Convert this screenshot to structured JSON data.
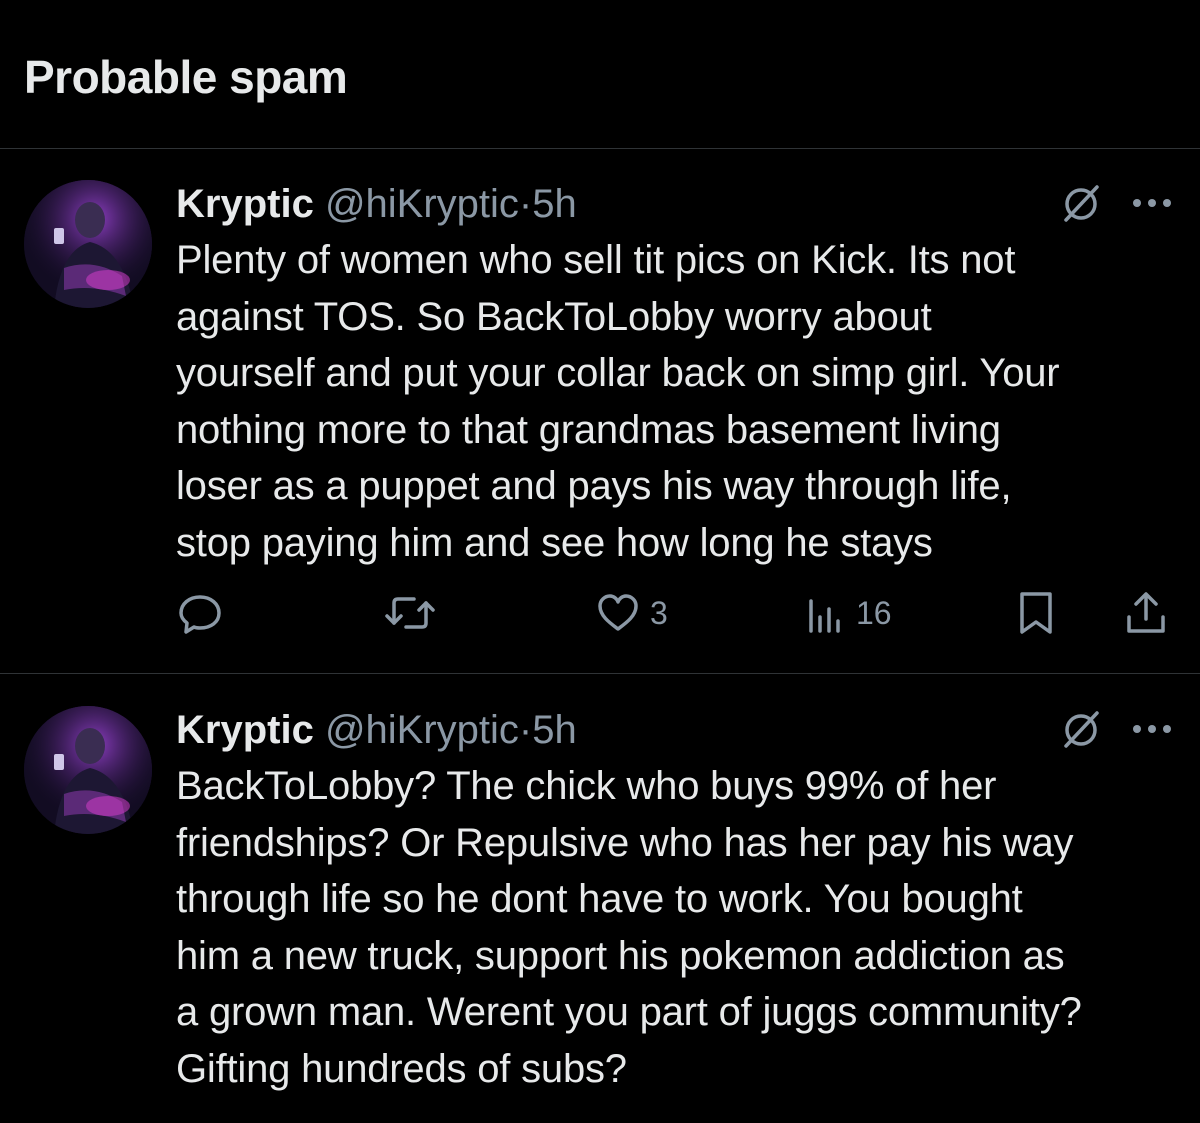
{
  "header": {
    "title": "Probable spam"
  },
  "tweets": [
    {
      "author_name": "Kryptic",
      "author_handle": "@hiKryptic",
      "separator": "·",
      "timestamp": "5h",
      "lines": [
        "Plenty of women who sell tit pics on Kick. Its not",
        "against TOS. So BackToLobby worry about",
        "yourself and put your collar back on simp girl. Your",
        "nothing more to that grandmas basement living",
        "loser as a puppet and pays his way through life,",
        "stop paying him and see how long he stays"
      ],
      "actions": {
        "reply_icon": "reply-icon",
        "retweet_icon": "retweet-icon",
        "like_icon": "heart-icon",
        "like_count": "3",
        "views_icon": "views-chart-icon",
        "views_count": "16",
        "bookmark_icon": "bookmark-icon",
        "share_icon": "share-icon"
      }
    },
    {
      "author_name": "Kryptic",
      "author_handle": "@hiKryptic",
      "separator": "·",
      "timestamp": "5h",
      "lines": [
        "BackToLobby? The chick who buys 99% of her",
        "friendships? Or Repulsive who has her pay his way",
        "through life so he dont have to work. You bought",
        "him a new truck, support his pokemon addiction as",
        "a grown man. Werent you part of juggs community?",
        "Gifting hundreds of subs?"
      ]
    }
  ],
  "colors": {
    "background": "#000000",
    "text_primary": "#e7e9ea",
    "text_secondary": "#8b98a5",
    "divider": "#2f3336"
  }
}
